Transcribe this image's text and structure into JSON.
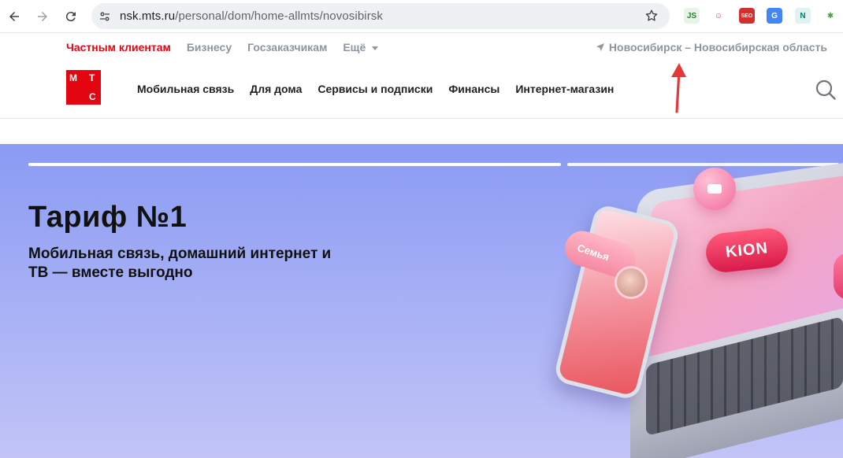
{
  "browser": {
    "url_host": "nsk.mts.ru",
    "url_path": "/personal/dom/home-allmts/novosibirsk",
    "extensions": [
      {
        "name": "js-extension-icon",
        "text": "JS",
        "bg": "#e8f4e8",
        "fg": "#2e7d32"
      },
      {
        "name": "smile-extension-icon",
        "text": "☺",
        "bg": "#ffffff",
        "fg": "#e53935"
      },
      {
        "name": "seo-extension-icon",
        "text": "SEO",
        "bg": "#d32f2f",
        "fg": "#ffffff"
      },
      {
        "name": "translate-extension-icon",
        "text": "G",
        "bg": "#4285f4",
        "fg": "#ffffff"
      },
      {
        "name": "n-extension-icon",
        "text": "N",
        "bg": "#e0f2f1",
        "fg": "#00796b"
      },
      {
        "name": "pinwheel-extension-icon",
        "text": "✱",
        "bg": "#ffffff",
        "fg": "#43a047"
      }
    ]
  },
  "topnav": {
    "items": [
      "Частным клиентам",
      "Бизнесу",
      "Госзаказчикам",
      "Ещё"
    ],
    "region": "Новосибирск – Новосибирская область"
  },
  "logo": {
    "letters": [
      "М",
      "Т",
      "С"
    ]
  },
  "mainnav": {
    "items": [
      "Мобильная связь",
      "Для дома",
      "Сервисы и подписки",
      "Финансы",
      "Интернет-магазин"
    ]
  },
  "hero": {
    "title": "Тариф №1",
    "subtitle": "Мобильная связь, домашний интернет и ТВ — вместе выгодно",
    "kion_label": "KION",
    "family_label": "Семья"
  },
  "colors": {
    "brand": "#e30611",
    "muted": "#8d969f",
    "annotation_arrow": "#e53935"
  }
}
